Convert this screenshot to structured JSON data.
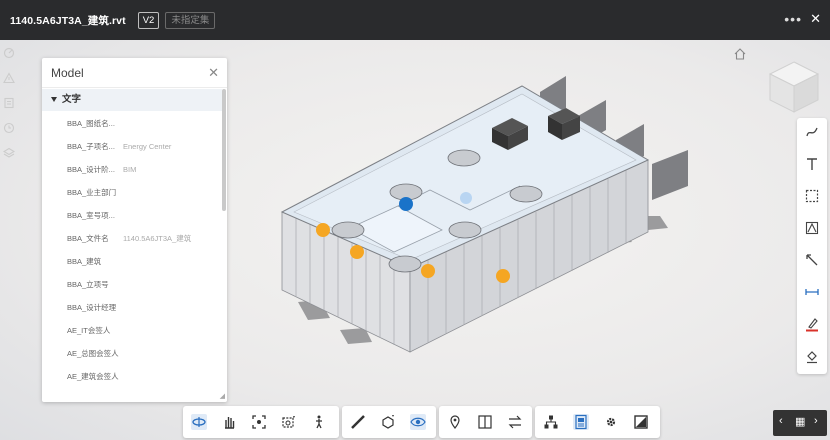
{
  "header": {
    "file_name": "1140.5A6JT3A_建筑.rvt",
    "version": "V2",
    "unlink_label": "未指定集"
  },
  "panel": {
    "title": "Model",
    "root": "文字",
    "rows": [
      {
        "label": "BBA_图纸名...",
        "value": ""
      },
      {
        "label": "BBA_子项名...",
        "value": "Energy Center"
      },
      {
        "label": "BBA_设计阶...",
        "value": "BIM"
      },
      {
        "label": "BBA_业主部门",
        "value": ""
      },
      {
        "label": "BBA_室号项...",
        "value": ""
      },
      {
        "label": "BBA_文件名",
        "value": "1140.5A6JT3A_建筑"
      },
      {
        "label": "BBA_建筑",
        "value": ""
      },
      {
        "label": "BBA_立项号",
        "value": ""
      },
      {
        "label": "BBA_设计经理",
        "value": ""
      },
      {
        "label": "AE_IT会签人",
        "value": ""
      },
      {
        "label": "AE_总图会签人",
        "value": ""
      },
      {
        "label": "AE_建筑会签人",
        "value": ""
      }
    ]
  },
  "colors": {
    "header_bg": "#2a2b2d",
    "accent_blue": "#1a73c9",
    "marker_orange": "#f5a623",
    "red_mark": "#d9322a"
  }
}
